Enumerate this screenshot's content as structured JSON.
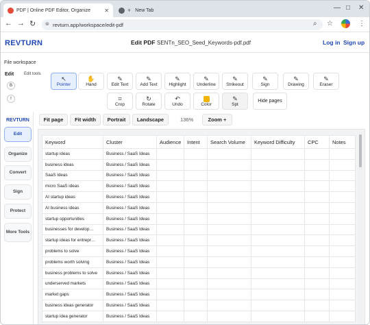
{
  "browser": {
    "tabs": [
      {
        "label": "PDF | Online PDF Editor, Organize"
      },
      {
        "label": "New Tab"
      }
    ],
    "url": "revturn.app/workspace/edit-pdf",
    "colors": {
      "tab_active_icon": "#e44b3b",
      "tab_inactive_icon": "#5f6368"
    }
  },
  "app": {
    "brand": "REVTURN",
    "page_label": "Edit PDF",
    "file_name": "SENTn_SEO_Seed_Keywords-pdf.pdf",
    "login": "Log in",
    "signup": "Sign up",
    "workspace_label": "File workspace",
    "accent": "#1f47b4"
  },
  "left_tools": {
    "label": "Edit",
    "sublabel": "Edit tools",
    "b1": "B",
    "b2": "I"
  },
  "toolbar": {
    "row1": [
      {
        "label": "Pointer",
        "icon": "pointer-icon",
        "glyph": "↖"
      },
      {
        "label": "Hand",
        "icon": "hand-icon",
        "glyph": "✋"
      },
      {
        "label": "Edit Text",
        "icon": "pencil-icon",
        "glyph": "✎"
      },
      {
        "label": "Add Text",
        "icon": "add-text-icon",
        "glyph": "✎"
      },
      {
        "label": "Highlight",
        "icon": "highlight-icon",
        "glyph": "✎"
      },
      {
        "label": "Underline",
        "icon": "underline-icon",
        "glyph": "✎"
      },
      {
        "label": "Strikeout",
        "icon": "strikeout-icon",
        "glyph": "✎"
      },
      {
        "label": "Sign",
        "icon": "sign-icon",
        "glyph": "✎"
      },
      {
        "label": "Drawing",
        "icon": "drawing-icon",
        "glyph": "✎"
      },
      {
        "label": "Eraser",
        "icon": "eraser-icon",
        "glyph": "✎"
      }
    ],
    "row2": [
      {
        "label": "Crop",
        "icon": "crop-icon",
        "glyph": "⌗"
      },
      {
        "label": "Rotate",
        "icon": "rotate-icon",
        "glyph": "↻"
      },
      {
        "label": "Undo",
        "icon": "undo-icon",
        "glyph": "↶"
      },
      {
        "label": "Color",
        "icon": "color-swatch-icon",
        "glyph": ""
      },
      {
        "label": "Spt",
        "icon": "pen-icon",
        "glyph": "✎"
      }
    ],
    "hide_pages": "Hide pages"
  },
  "sidebar": {
    "brand": "REVTURN",
    "items": [
      "Edit",
      "Organize",
      "Convert",
      "Sign",
      "Protect",
      "More Tools"
    ]
  },
  "view": {
    "buttons": [
      "Fit page",
      "Fit width",
      "Portrait",
      "Landscape"
    ],
    "zoom": "136%",
    "zoom_btn": "Zoom +"
  },
  "table": {
    "columns": [
      "Keyword",
      "Cluster",
      "Audience",
      "Intent",
      "Search Volume",
      "Keyword Difficulty",
      "CPC",
      "Notes"
    ],
    "rows": [
      [
        "startup ideas",
        "Business / SaaS Ideas"
      ],
      [
        "business ideas",
        "Business / SaaS Ideas"
      ],
      [
        "SaaS Ideas",
        "Business / SaaS Ideas"
      ],
      [
        "micro SaaS ideas",
        "Business / SaaS Ideas"
      ],
      [
        "AI startup ideas",
        "Business / SaaS Ideas"
      ],
      [
        "AI business ideas",
        "Business / SaaS Ideas"
      ],
      [
        "startup opportunities",
        "Business / SaaS Ideas"
      ],
      [
        "businesses for develop…",
        "Business / SaaS Ideas"
      ],
      [
        "startup ideas for entrepr…",
        "Business / SaaS Ideas"
      ],
      [
        "problems to solve",
        "Business / SaaS Ideas"
      ],
      [
        "problems worth solving",
        "Business / SaaS Ideas"
      ],
      [
        "business problems to solve",
        "Business / SaaS Ideas"
      ],
      [
        "underserved markets",
        "Business / SaaS Ideas"
      ],
      [
        "market gaps",
        "Business / SaaS Ideas"
      ],
      [
        "business ideas generator",
        "Business / SaaS Ideas"
      ],
      [
        "startup idea generator",
        "Business / SaaS Ideas"
      ]
    ]
  }
}
